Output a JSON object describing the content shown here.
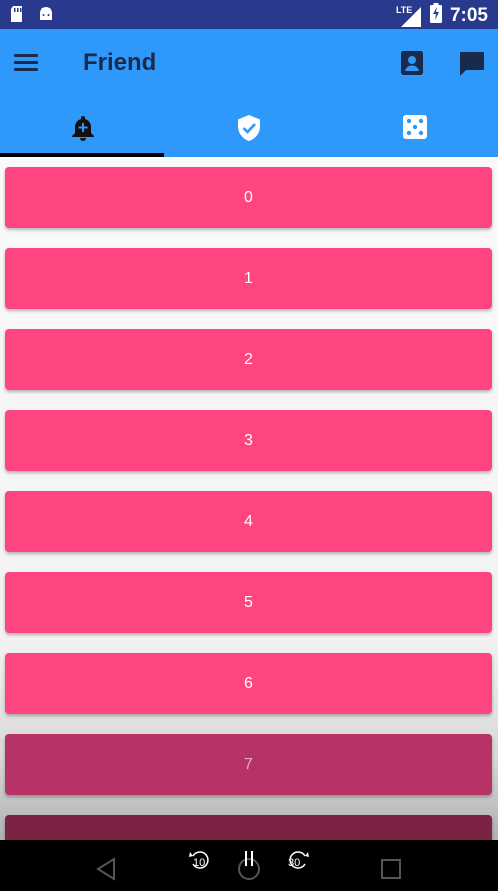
{
  "status_bar": {
    "time": "7:05",
    "network_label": "LTE",
    "icons": [
      "sd-card-icon",
      "android-icon",
      "signal-icon",
      "battery-charging-icon"
    ]
  },
  "app_bar": {
    "title": "Friend",
    "icons": [
      "menu-icon",
      "contact-icon",
      "chat-icon"
    ]
  },
  "tabs": [
    {
      "icon": "bell-plus-icon",
      "selected": true
    },
    {
      "icon": "shield-check-icon",
      "selected": false
    },
    {
      "icon": "dice-icon",
      "selected": false
    }
  ],
  "list": {
    "items": [
      "0",
      "1",
      "2",
      "3",
      "4",
      "5",
      "6",
      "7"
    ]
  },
  "nav_bar": {
    "rewind_label": "10",
    "forward_label": "30",
    "icons": [
      "back-icon",
      "rewind-icon",
      "pause-icon",
      "forward-icon",
      "recent-apps-icon"
    ]
  },
  "colors": {
    "status_bar": "#28398e",
    "app_bar": "#2f99fb",
    "item": "#fe4580",
    "title_text": "#1a2a4a"
  }
}
